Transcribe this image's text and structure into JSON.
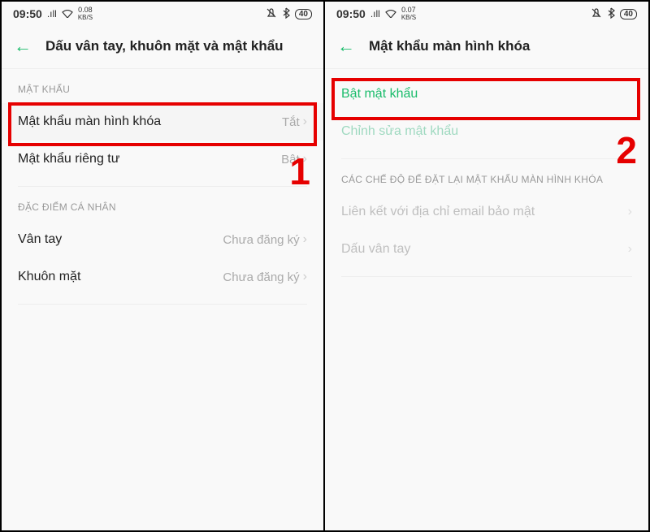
{
  "left": {
    "statusbar": {
      "time": "09:50",
      "signal": ".ıll",
      "wifi_icon": "⌔",
      "speed_value": "0.08",
      "speed_unit": "KB/S",
      "mute_icon": "🔕",
      "bt_icon": "⁂",
      "battery": "40"
    },
    "back_icon": "←",
    "title": "Dấu vân tay, khuôn mặt và mật khẩu",
    "sections": {
      "password": {
        "header": "MẬT KHẨU",
        "rows": [
          {
            "label": "Mật khẩu màn hình khóa",
            "value": "Tắt"
          },
          {
            "label": "Mật khẩu riêng tư",
            "value": "Bật"
          }
        ]
      },
      "personal": {
        "header": "ĐẶC ĐIỂM CÁ NHÂN",
        "rows": [
          {
            "label": "Vân tay",
            "value": "Chưa đăng ký"
          },
          {
            "label": "Khuôn mặt",
            "value": "Chưa đăng ký"
          }
        ]
      }
    },
    "step_number": "1"
  },
  "right": {
    "statusbar": {
      "time": "09:50",
      "signal": ".ıll",
      "wifi_icon": "⌔",
      "speed_value": "0.07",
      "speed_unit": "KB/S",
      "mute_icon": "🔕",
      "bt_icon": "⁂",
      "battery": "40"
    },
    "back_icon": "←",
    "title": "Mật khẩu màn hình khóa",
    "rows": {
      "enable": {
        "label": "Bật mật khẩu"
      },
      "edit": {
        "label": "Chỉnh sửa mật khẩu"
      }
    },
    "reset_section": {
      "header": "CÁC CHẾ ĐỘ ĐỂ ĐẶT LẠI MẬT KHẨU MÀN HÌNH KHÓA",
      "rows": [
        {
          "label": "Liên kết với địa chỉ email bảo mật"
        },
        {
          "label": "Dấu vân tay"
        }
      ]
    },
    "step_number": "2"
  },
  "chevron": "›"
}
